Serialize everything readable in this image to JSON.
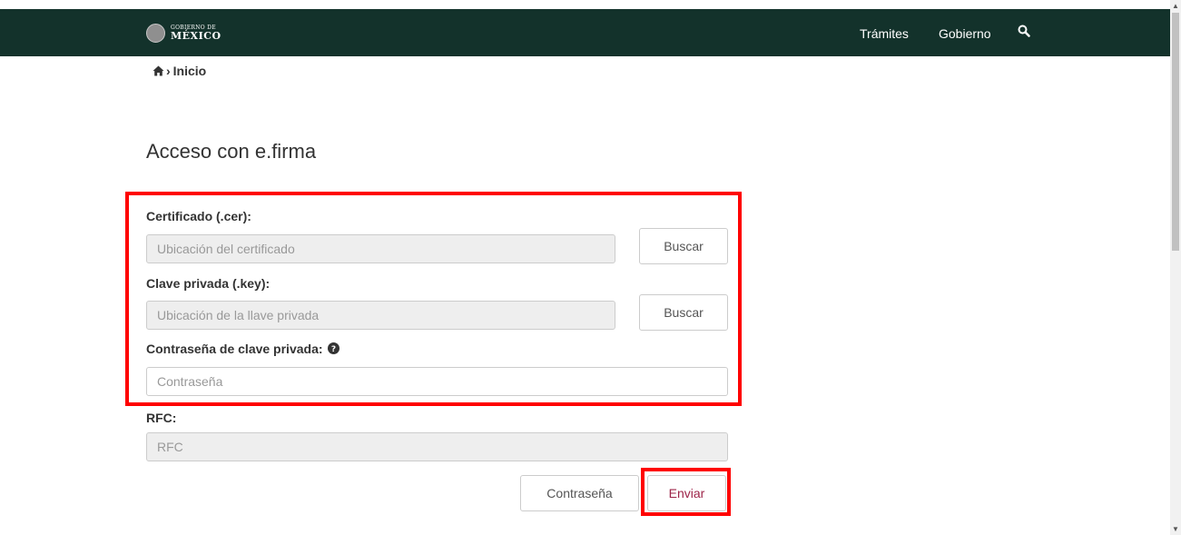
{
  "header": {
    "logo_small": "GOBIERNO DE",
    "logo_big": "MÉXICO",
    "nav": [
      "Trámites",
      "Gobierno"
    ],
    "search_icon": "search-icon",
    "bg_color": "#13322b"
  },
  "breadcrumb": {
    "home_icon": "home-icon",
    "separator": "›",
    "label": "Inicio"
  },
  "page_title": "Acceso con e.firma",
  "form": {
    "cert_label": "Certificado (.cer):",
    "cert_placeholder": "Ubicación del certificado",
    "key_label": "Clave privada (.key):",
    "key_placeholder": "Ubicación de la llave privada",
    "browse_label": "Buscar",
    "password_label": "Contraseña de clave privada:",
    "password_placeholder": "Contraseña",
    "rfc_label": "RFC:",
    "rfc_placeholder": "RFC",
    "btn_password": "Contraseña",
    "btn_submit": "Enviar"
  },
  "colors": {
    "highlight": "#ff0000",
    "submit_text": "#9d2449"
  }
}
